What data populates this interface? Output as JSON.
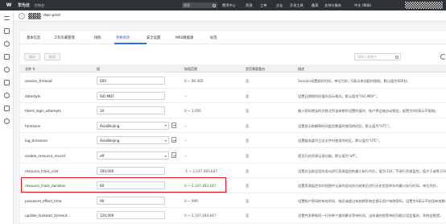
{
  "topnav": {
    "logo_text": "W",
    "brand": "华为云",
    "console": "控制台",
    "search_placeholder": "搜索",
    "links": [
      "费用中心",
      "资源",
      "工单",
      "企业",
      "开发工具",
      "备案",
      "支持与服务",
      "中文 (简体)"
    ]
  },
  "instance": {
    "name": "dws-prod"
  },
  "tabs": [
    "基本信息",
    "工作负载管理",
    "快照",
    "参数修改",
    "安全设置",
    "MRS数据源",
    "标签"
  ],
  "active_tab": "参数修改",
  "toolbar": {
    "save_label": "保存",
    "cancel_label": "取消",
    "search_placeholder": "请输入参数名"
  },
  "table": {
    "headers": [
      "名称 ⇅",
      "值",
      "取值范围",
      "是否需要重启",
      "描述"
    ],
    "rows": [
      {
        "name": "session_timeout",
        "value": "600",
        "type": "input",
        "range": "0 ~ 86,400",
        "restart": "否",
        "desc": "Session闲置超时时间，单位为秒，0表示关闭超时限制。默认值为600秒。"
      },
      {
        "name": "datestyle",
        "value": "ISO,MDY",
        "type": "input",
        "range": "--",
        "restart": "否",
        "desc": "设置日期和时间值的显示格式。默认值为\"ISO,MDY\"。"
      },
      {
        "name": "failed_login_attempts",
        "value": "10",
        "type": "input",
        "range": "0 ~ 1,000",
        "restart": "否",
        "desc": "输入密码错误的次数达到该参数所设置的值时，帐户将会被自动锁定。配置为0时表示不限制。"
      },
      {
        "name": "timezone",
        "value": "Asia/Beijing",
        "type": "select",
        "range": "--",
        "restart": "否",
        "desc": "设置显示和解释时间类型数值时使用的时区。默认值为\"UTC\"。"
      },
      {
        "name": "log_timezone",
        "value": "Asia/Beijing",
        "type": "select",
        "range": "--",
        "restart": "否",
        "desc": "设置服务器写日志文件时使用的时区。默认值为\"UTC\"。"
      },
      {
        "name": "enable_resource_record",
        "value": "off",
        "type": "select",
        "range": "--",
        "restart": "否",
        "desc": "是否开启资源记录功能。默认值为\"off\"。"
      },
      {
        "name": "resource_track_cost",
        "value": "100,000",
        "type": "input",
        "range": "-1 ~ 2,147,483,647",
        "restart": "否",
        "desc": "设置对当前会话的语句进行资源监控的最小执行代价，值为-1时，不进行资源监控。值大于或等于0时…"
      },
      {
        "name": "resource_track_duration",
        "value": "60",
        "type": "input",
        "range": "0 ~ 2,147,483,647",
        "restart": "否",
        "desc": "设置资源监控实时视图中记录的语句执行结束后进行历史信息转存的最小执行时间，单位为秒。"
      },
      {
        "name": "password_effect_time",
        "value": "90",
        "type": "input",
        "range": "0 ~ 999",
        "restart": "否",
        "desc": "设置帐户密码的有效时间，临近或超过有效期系统会提示用户修改密码。设置为0表示不启用有效期…"
      },
      {
        "name": "update_lockwait_timeout",
        "value": "120,000",
        "type": "input",
        "range": "0 ~ 2,147,483,647",
        "restart": "否",
        "desc": "设置并发更新同一行时单个锁的最长等待时间，当申请的锁等待时间超过设定值时，系统会报错。"
      }
    ]
  },
  "highlight_row": "enable_resource_record",
  "colors": {
    "accent": "#2a6ee8",
    "highlight": "#e0161c",
    "topbar": "#2e3237"
  }
}
